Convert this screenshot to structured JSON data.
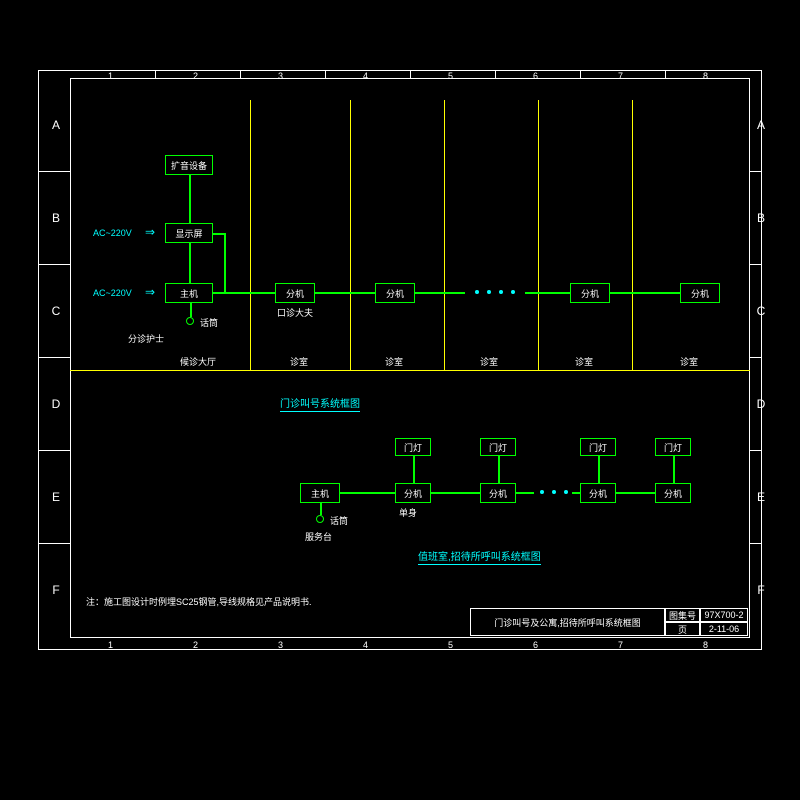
{
  "grid": {
    "cols": [
      "1",
      "2",
      "3",
      "4",
      "5",
      "6",
      "7",
      "8"
    ],
    "rows": [
      "A",
      "B",
      "C",
      "D",
      "E",
      "F"
    ]
  },
  "diagram1": {
    "power": "AC~220V",
    "amp": "扩音设备",
    "display": "显示屏",
    "host": "主机",
    "mic": "话筒",
    "nurse": "分诊护士",
    "branch": "分机",
    "dabing": "口诊大夫",
    "zone_hall": "候诊大厅",
    "zone_room": "诊室",
    "title": "门诊叫号系统框图"
  },
  "diagram2": {
    "host": "主机",
    "mic": "话筒",
    "desk": "服务台",
    "light": "门灯",
    "branch": "分机",
    "single": "单身",
    "zone_duty": "值班室,招待所呼叫系统框图",
    "title": "值班室,招待所呼叫系统框图"
  },
  "note": "注：施工图设计时例埋SC25钢管,导线规格见产品说明书.",
  "titleblock": {
    "main": "门诊叫号及公寓,招待所呼叫系统框图",
    "sheet_set_lbl": "图集号",
    "sheet_set": "97X700-2",
    "page_lbl": "页",
    "page": "2-11-06"
  }
}
